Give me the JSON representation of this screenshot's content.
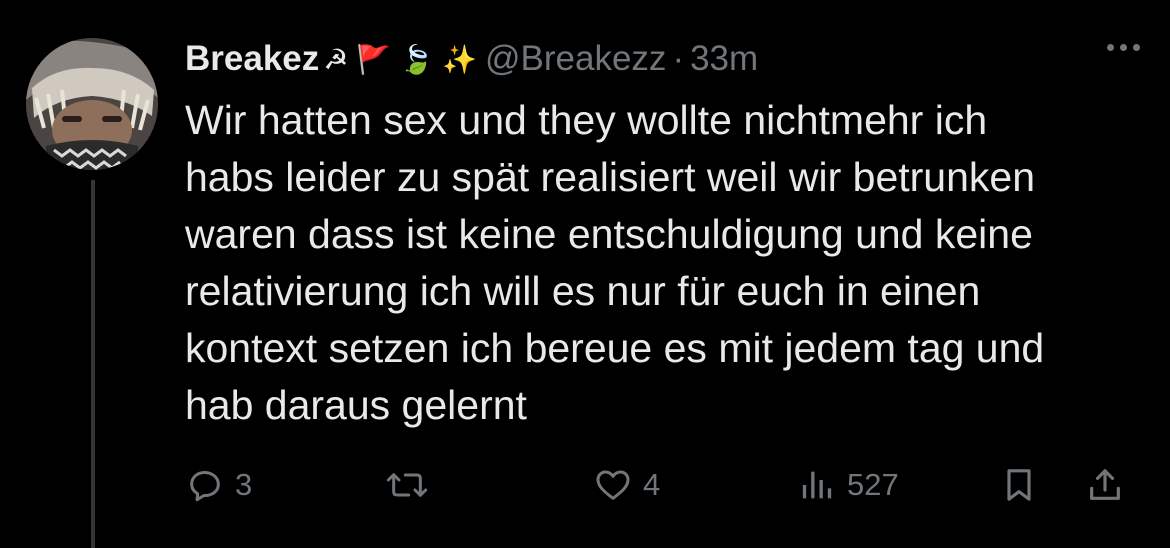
{
  "user": {
    "display_name": "Breakez",
    "emojis": [
      "☭",
      "🚩",
      "🍃",
      "✨"
    ],
    "handle": "@Breakezz",
    "separator": "·",
    "time": "33m"
  },
  "tweet": {
    "text": "Wir hatten sex und they wollte nichtmehr ich\nhabs leider zu spät realisiert weil wir betrunken\nwaren dass ist keine entschuldigung und keine\nrelativierung ich will es nur für euch in einen\nkontext setzen ich bereue es mit jedem tag und\nhab daraus gelernt"
  },
  "actions": {
    "replies": "3",
    "retweets": "",
    "likes": "4",
    "views": "527"
  },
  "icons": {
    "avatar": "profile-photo",
    "more": "more-dots-icon",
    "reply": "reply-bubble-icon",
    "retweet": "retweet-arrows-icon",
    "like": "heart-icon",
    "views": "analytics-bars-icon",
    "bookmark": "bookmark-icon",
    "share": "share-upload-icon"
  },
  "colors": {
    "background": "#000000",
    "text": "#e7e9ea",
    "muted": "#71767b",
    "thread_line": "#333639"
  }
}
